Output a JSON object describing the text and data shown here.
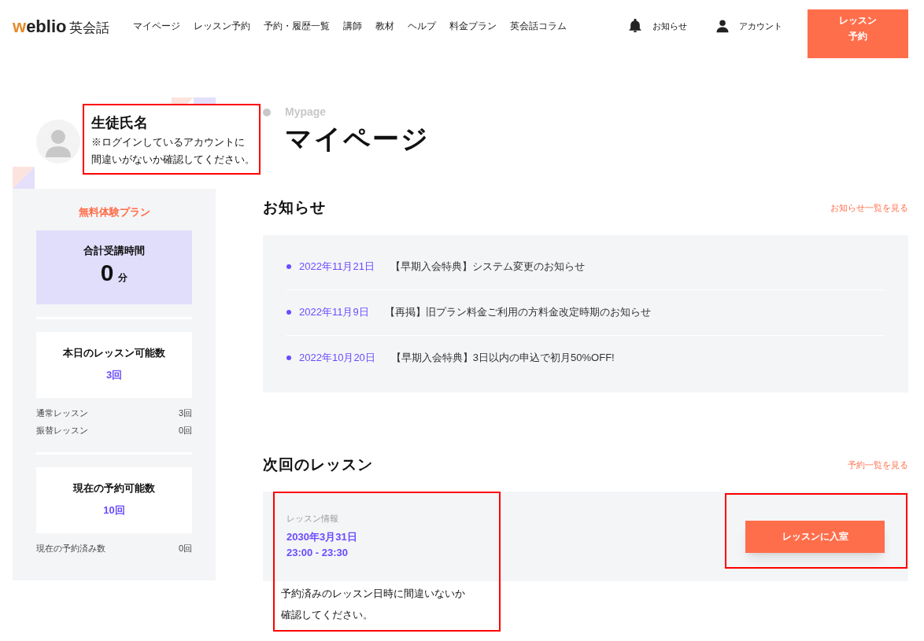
{
  "header": {
    "logo_accent": "w",
    "logo_text": "eblio",
    "logo_suffix": "英会話",
    "nav": [
      "マイページ",
      "レッスン予約",
      "予約・履歴一覧",
      "講師",
      "教材",
      "ヘルプ",
      "料金プラン",
      "英会話コラム"
    ],
    "actions": [
      {
        "kind": "bell",
        "label": "お知らせ"
      },
      {
        "kind": "person",
        "label": "アカウント"
      }
    ],
    "cta": "レッスン予約"
  },
  "profile_callout": {
    "title": "生徒氏名",
    "lines": [
      "※ログインしているアカウントに",
      "間違いがないか確認してください。"
    ]
  },
  "page_heading": {
    "eyebrow": "Mypage",
    "title": "マイページ"
  },
  "sidebar": {
    "plan": "無料体験プラン",
    "total": {
      "label": "合計受講時間",
      "value": "0",
      "unit": "分"
    },
    "cards": [
      {
        "title": "本日のレッスン可能数",
        "value": "3回",
        "rows": [
          {
            "label": "通常レッスン",
            "value": "3回"
          },
          {
            "label": "振替レッスン",
            "value": "0回"
          }
        ]
      },
      {
        "title": "現在の予約可能数",
        "value": "10回",
        "rows": [
          {
            "label": "現在の予約済み数",
            "value": "0回"
          }
        ]
      }
    ]
  },
  "news": {
    "title": "お知らせ",
    "link": "お知らせ一覧を見る",
    "items": [
      {
        "date": "2022年11月21日",
        "title": "【早期入会特典】システム変更のお知らせ"
      },
      {
        "date": "2022年11月9日",
        "title": "【再掲】旧プラン料金ご利用の方料金改定時期のお知らせ"
      },
      {
        "date": "2022年10月20日",
        "title": "【早期入会特典】3日以内の申込で初月50%OFF!"
      }
    ]
  },
  "next_lesson": {
    "title": "次回のレッスン",
    "link": "予約一覧を見る",
    "info_label": "レッスン情報",
    "date": "2030年3月31日",
    "time": "23:00 - 23:30",
    "button": "レッスンに入室",
    "note_lines": [
      "予約済みのレッスン日時に間違いないか",
      "確認してください。"
    ]
  }
}
